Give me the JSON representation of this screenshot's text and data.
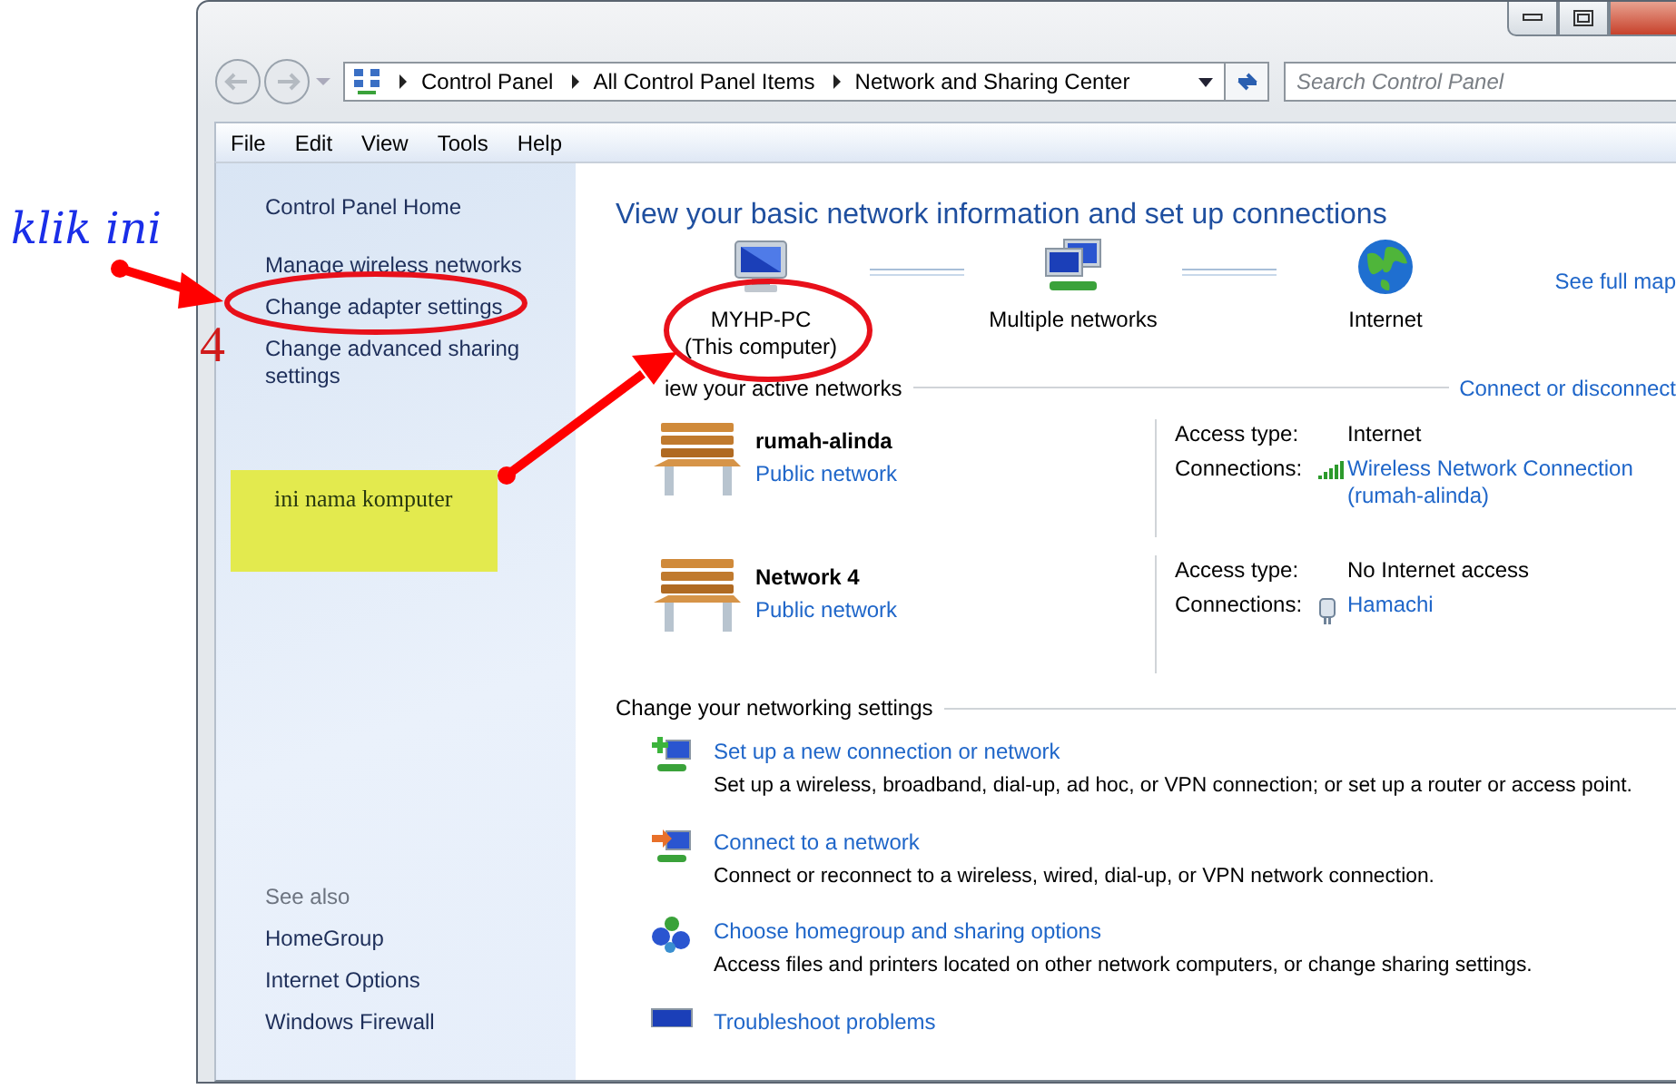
{
  "address_bar": {
    "breadcrumbs": [
      "Control Panel",
      "All Control Panel Items",
      "Network and Sharing Center"
    ]
  },
  "search": {
    "placeholder": "Search Control Panel"
  },
  "menu": [
    "File",
    "Edit",
    "View",
    "Tools",
    "Help"
  ],
  "sidebar": {
    "links": [
      "Control Panel Home",
      "Manage wireless networks",
      "Change adapter settings",
      "Change advanced sharing settings"
    ],
    "see_also": {
      "title": "See also",
      "links": [
        "HomeGroup",
        "Internet Options",
        "Windows Firewall"
      ]
    }
  },
  "content": {
    "title": "View your basic network information and set up connections",
    "map": {
      "nodes": [
        {
          "kind": "computer",
          "label": "MYHP-PC",
          "sublabel": "(This computer)"
        },
        {
          "kind": "networks",
          "label": "Multiple networks"
        },
        {
          "kind": "internet",
          "label": "Internet"
        }
      ],
      "link": "See full map"
    },
    "active_networks": {
      "heading": "iew your active networks",
      "link": "Connect or disconnect",
      "networks": [
        {
          "name": "rumah-alinda",
          "category": "Public network",
          "access_label": "Access type:",
          "access": "Internet",
          "connections_label": "Connections:",
          "connection": {
            "kind": "wireless",
            "label": "Wireless Network Connection (rumah-alinda)"
          }
        },
        {
          "name": "Network  4",
          "category": "Public network",
          "access_label": "Access type:",
          "access": "No Internet access",
          "connections_label": "Connections:",
          "connection": {
            "kind": "adapter",
            "label": "Hamachi"
          }
        }
      ]
    },
    "settings": {
      "heading": "Change your networking settings",
      "tasks": [
        {
          "kind": "new-connection",
          "link": "Set up a new connection or network",
          "description": "Set up a wireless, broadband, dial-up, ad hoc, or VPN connection; or set up a router or access point."
        },
        {
          "kind": "connect",
          "link": "Connect to a network",
          "description": "Connect or reconnect to a wireless, wired, dial-up, or VPN network connection."
        },
        {
          "kind": "homegroup",
          "link": "Choose homegroup and sharing options",
          "description": "Access files and printers located on other network computers, or change sharing settings."
        },
        {
          "kind": "troubleshoot",
          "link": "Troubleshoot problems"
        }
      ]
    }
  },
  "annotations": {
    "click_label": "klik ini",
    "step_number": "4",
    "note": "ini nama komputer"
  }
}
